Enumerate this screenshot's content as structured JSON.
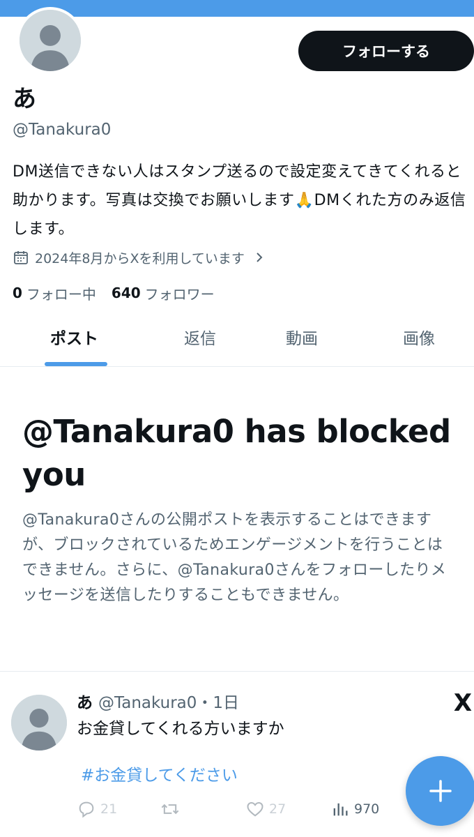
{
  "profile": {
    "display_name": "あ",
    "handle": "@Tanakura0",
    "follow_button": "フォローする",
    "bio": "DM送信できない人はスタンプ送るので設定変えてきてくれると助かります。写真は交換でお願いします🙏DMくれた方のみ返信します。",
    "joined": "2024年8月からXを利用しています",
    "following_count": "0",
    "following_label": "フォロー中",
    "followers_count": "640",
    "followers_label": "フォロワー"
  },
  "tabs": [
    {
      "label": "ポスト",
      "active": true
    },
    {
      "label": "返信",
      "active": false
    },
    {
      "label": "動画",
      "active": false
    },
    {
      "label": "画像",
      "active": false
    }
  ],
  "blocked": {
    "title": "@Tanakura0 has blocked you",
    "description": "@Tanakura0さんの公開ポストを表示することはできますが、ブロックされているためエンゲージメントを行うことはできません。さらに、@Tanakura0さんをフォローしたりメッセージを送信したりすることもできません。"
  },
  "tweet": {
    "name": "あ",
    "handle_time": "@Tanakura0・1日",
    "text": "お金貸してくれる方いますか",
    "hashtag": "#お金貸してください",
    "replies": "21",
    "reposts": "",
    "likes": "27",
    "views": "970",
    "source_logo": "X"
  },
  "colors": {
    "accent": "#4c9be8",
    "text": "#0f1419",
    "muted": "#536471"
  },
  "icons": [
    "calendar-icon",
    "chevron-right-icon",
    "reply-icon",
    "repost-icon",
    "like-icon",
    "views-icon",
    "compose-plus-icon",
    "x-logo-icon"
  ]
}
